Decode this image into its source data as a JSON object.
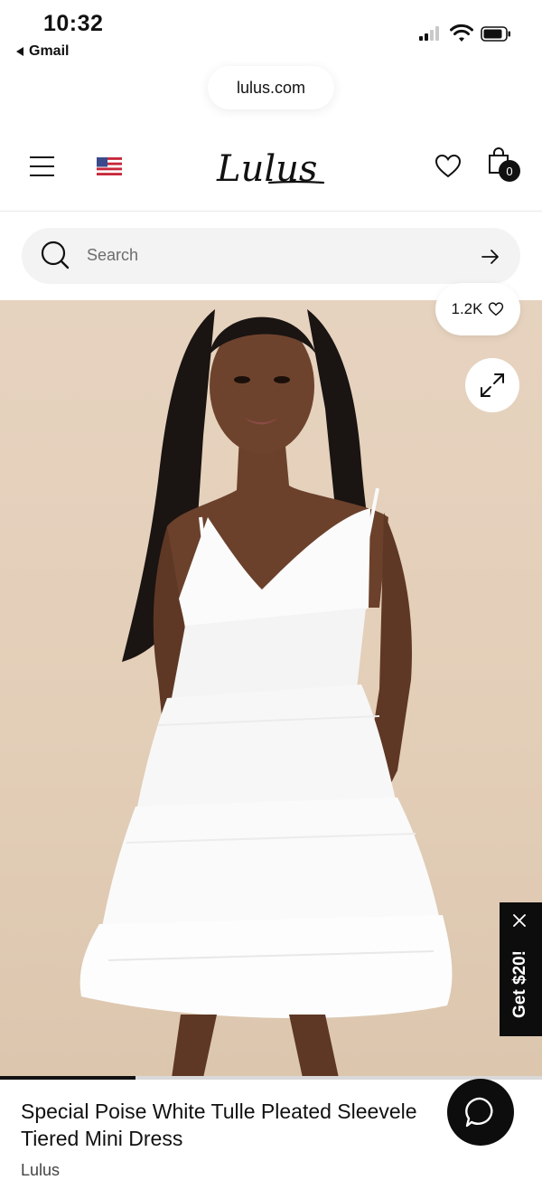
{
  "status_bar": {
    "time": "10:32",
    "back_app": "Gmail"
  },
  "browser": {
    "url": "lulus.com"
  },
  "header": {
    "logo_text": "Lulus",
    "cart_count": "0"
  },
  "search": {
    "placeholder": "Search"
  },
  "product": {
    "like_count": "1.2K",
    "title_line1": "Special Poise White Tulle Pleated Sleevele",
    "title_line2": "Tiered Mini Dress",
    "brand": "Lulus",
    "gallery_progress": 0.25
  },
  "promo": {
    "label": "Get $20!"
  },
  "colors": {
    "primary": "#111111",
    "photo_bg": "#e4d0bb",
    "search_bg": "#f3f3f3"
  }
}
